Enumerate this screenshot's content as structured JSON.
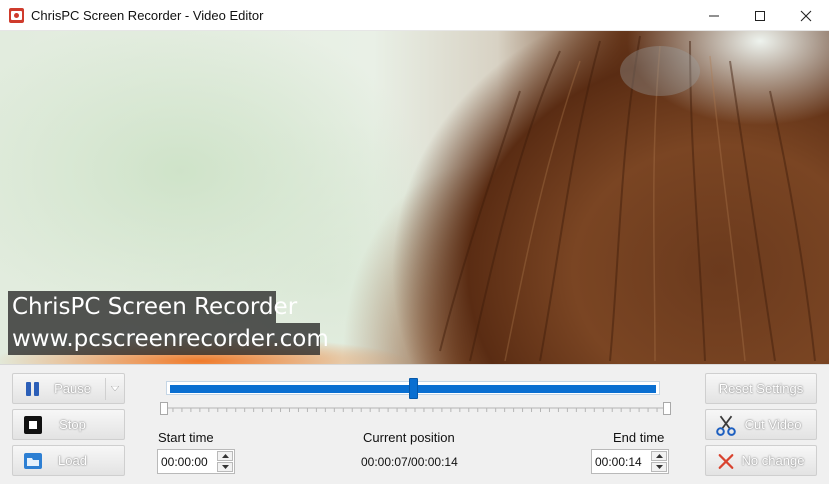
{
  "window": {
    "title": "ChrisPC Screen Recorder - Video Editor",
    "icons": {
      "app": "record-camera-icon",
      "minimize": "minimize-icon",
      "maximize": "maximize-icon",
      "close": "close-icon"
    }
  },
  "video": {
    "watermark_line1": "ChrisPC Screen Recorder",
    "watermark_line2": "www.pcscreenrecorder.com"
  },
  "playback": {
    "pause_label": "Pause",
    "stop_label": "Stop",
    "load_label": "Load",
    "icons": {
      "pause": "pause-icon",
      "stop": "stop-icon",
      "load": "folder-icon",
      "dropdown": "chevron-down-icon"
    }
  },
  "timeline": {
    "position_fraction": 0.5,
    "current_seconds": 7,
    "total_seconds": 14,
    "progress_color": "#0a6fd1"
  },
  "time": {
    "start_label": "Start time",
    "current_label": "Current position",
    "end_label": "End time",
    "start_value": "00:00:00",
    "current_value": "00:00:07/00:00:14",
    "end_value": "00:00:14"
  },
  "actions": {
    "reset_label": "Reset Settings",
    "cut_label": "Cut Video",
    "nochange_label": "No change",
    "icons": {
      "cut": "scissors-icon",
      "nochange": "x-icon"
    }
  }
}
